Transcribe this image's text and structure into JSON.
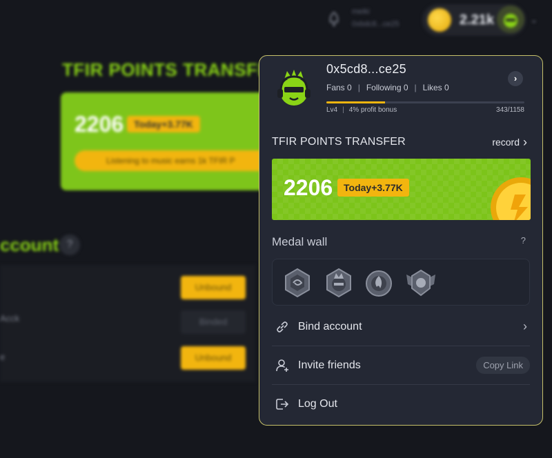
{
  "background": {
    "username": "meiki",
    "user_sub": "0xbdc8...ce25",
    "coin_amount": "2.21k",
    "page_title": "TFIR POINTS TRANSFE",
    "points_value": "2206",
    "today_badge": "Today+3.77K",
    "earn_banner": "Listening to music earns 1k TFIR P",
    "account_title": "ccount",
    "account_help": "?",
    "rows": [
      {
        "label": "",
        "button": "Unbound"
      },
      {
        "label": "Acck",
        "button": "Binded"
      },
      {
        "label": "e",
        "button": "Unbound"
      }
    ]
  },
  "popup": {
    "wallet_address": "0x5cd8...ce25",
    "stats": {
      "fans": "Fans 0",
      "following": "Following 0",
      "likes": "Likes 0",
      "separator": "|"
    },
    "level": {
      "label": "Lv4",
      "bonus": "4% profit bonus",
      "progress_text": "343/1158",
      "progress_fraction": 0.296
    },
    "transfer_title": "TFIR POINTS TRANSFER",
    "record_label": "record",
    "points": {
      "value": "2206",
      "today": "Today+3.77K"
    },
    "medal_wall": {
      "title": "Medal wall",
      "help": "?",
      "medals": [
        "medal-swirl",
        "medal-mascot",
        "medal-flame",
        "medal-wings"
      ]
    },
    "menu": {
      "bind_account": "Bind account",
      "invite_friends": "Invite friends",
      "copy_link": "Copy Link",
      "log_out": "Log Out"
    }
  },
  "colors": {
    "accent_green": "#7cc41a",
    "accent_yellow": "#f2b50f",
    "popup_border": "#c7c26a",
    "popup_bg": "#242834"
  }
}
